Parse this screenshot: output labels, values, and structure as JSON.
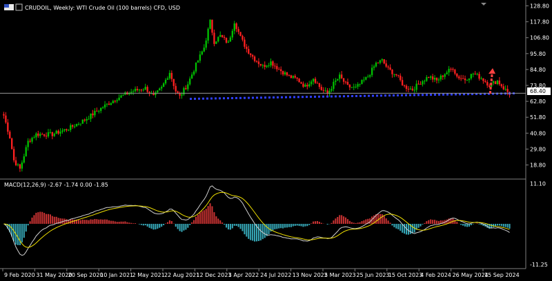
{
  "window": {
    "title": "CRUDOIL, Weekly:  WTI Crude Oil (100 barrels) CFD, USD",
    "indicator_label": "MACD(12,26,9) -2.67 -1.74 0.00 -1.85",
    "current_price_label": "68.40"
  },
  "colors": {
    "background": "#000000",
    "bull": "#00c000",
    "bear": "#ff2020",
    "hist_pos": "#c83232",
    "hist_neg": "#36a8b8",
    "macd_line": "#d0d0d0",
    "signal_line": "#f0e000",
    "support": "#3040ff",
    "arrow": "#ff4040"
  },
  "chart_data": [
    {
      "type": "candlestick",
      "title": "CRUDOIL, Weekly:  WTI Crude Oil (100 barrels) CFD, USD",
      "x_ticks": [
        "9 Feb 2020",
        "31 May 2020",
        "20 Sep 2020",
        "10 Jan 2021",
        "2 May 2021",
        "22 Aug 2021",
        "12 Dec 2021",
        "3 Apr 2022",
        "24 Jul 2022",
        "13 Nov 2022",
        "5 Mar 2023",
        "25 Jun 2023",
        "15 Oct 2023",
        "4 Feb 2024",
        "26 May 2024",
        "15 Sep 2024"
      ],
      "y_ticks": [
        "128.80",
        "117.80",
        "106.80",
        "95.80",
        "84.80",
        "73.80",
        "62.80",
        "51.80",
        "40.80",
        "29.80",
        "18.80"
      ],
      "ylim": [
        10,
        130
      ],
      "current_price": 68.4,
      "support_level": 65,
      "close_anchors": [
        [
          0,
          53
        ],
        [
          3,
          38
        ],
        [
          5,
          22
        ],
        [
          8,
          16
        ],
        [
          12,
          35
        ],
        [
          16,
          40
        ],
        [
          24,
          40
        ],
        [
          32,
          44
        ],
        [
          40,
          50
        ],
        [
          48,
          58
        ],
        [
          56,
          65
        ],
        [
          64,
          70
        ],
        [
          70,
          72
        ],
        [
          74,
          66
        ],
        [
          78,
          72
        ],
        [
          82,
          83
        ],
        [
          85,
          70
        ],
        [
          87,
          66
        ],
        [
          91,
          75
        ],
        [
          95,
          88
        ],
        [
          99,
          100
        ],
        [
          102,
          118
        ],
        [
          104,
          104
        ],
        [
          107,
          108
        ],
        [
          111,
          103
        ],
        [
          114,
          118
        ],
        [
          117,
          107
        ],
        [
          120,
          99
        ],
        [
          124,
          92
        ],
        [
          128,
          87
        ],
        [
          132,
          90
        ],
        [
          136,
          85
        ],
        [
          141,
          80
        ],
        [
          145,
          78
        ],
        [
          149,
          73
        ],
        [
          153,
          79
        ],
        [
          157,
          71
        ],
        [
          160,
          68
        ],
        [
          163,
          75
        ],
        [
          166,
          80
        ],
        [
          170,
          73
        ],
        [
          174,
          72
        ],
        [
          180,
          80
        ],
        [
          184,
          89
        ],
        [
          187,
          91
        ],
        [
          190,
          85
        ],
        [
          194,
          81
        ],
        [
          198,
          73
        ],
        [
          202,
          71
        ],
        [
          206,
          76
        ],
        [
          210,
          80
        ],
        [
          214,
          77
        ],
        [
          218,
          82
        ],
        [
          222,
          86
        ],
        [
          224,
          80
        ],
        [
          228,
          78
        ],
        [
          232,
          82
        ],
        [
          236,
          79
        ],
        [
          240,
          74
        ],
        [
          244,
          77
        ],
        [
          247,
          72
        ],
        [
          250,
          68
        ]
      ]
    },
    {
      "type": "macd",
      "label": "MACD(12,26,9) -2.67 -1.74 0.00 -1.85",
      "y_ticks": [
        "11.10",
        "-11.25"
      ],
      "ylim": [
        -12,
        12
      ],
      "values": {
        "macd": -2.67,
        "signal": -1.74,
        "zero": 0.0,
        "histogram": -1.85
      }
    }
  ]
}
